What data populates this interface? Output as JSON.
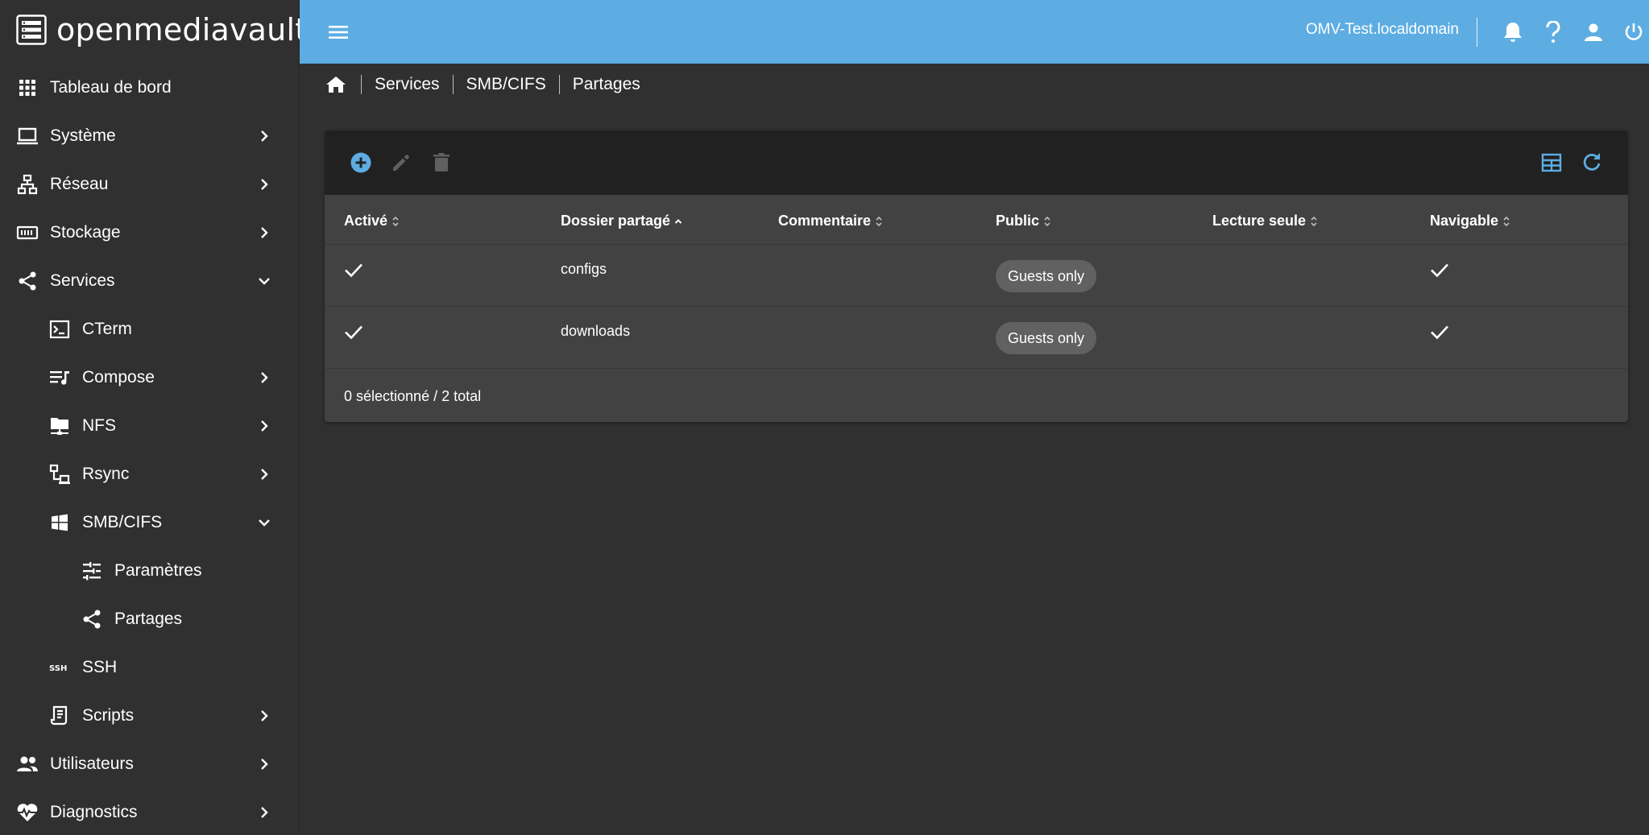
{
  "brand": {
    "name": "openmediavault"
  },
  "topbar": {
    "hostname": "OMV-Test.localdomain"
  },
  "sidebar": {
    "items": [
      {
        "label": "Tableau de bord",
        "icon": "dashboard-grid-icon"
      },
      {
        "label": "Système",
        "icon": "laptop-icon"
      },
      {
        "label": "Réseau",
        "icon": "network-icon"
      },
      {
        "label": "Stockage",
        "icon": "storage-icon"
      },
      {
        "label": "Services",
        "icon": "share-icon"
      },
      {
        "label": "CTerm",
        "icon": "console-icon"
      },
      {
        "label": "Compose",
        "icon": "playlist-music-icon"
      },
      {
        "label": "NFS",
        "icon": "folder-network-icon"
      },
      {
        "label": "Rsync",
        "icon": "lan-icon"
      },
      {
        "label": "SMB/CIFS",
        "icon": "windows-icon"
      },
      {
        "label": "Paramètres",
        "icon": "tune-icon"
      },
      {
        "label": "Partages",
        "icon": "share-icon"
      },
      {
        "label": "SSH",
        "icon": "ssh-icon"
      },
      {
        "label": "Scripts",
        "icon": "script-icon"
      },
      {
        "label": "Utilisateurs",
        "icon": "users-icon"
      },
      {
        "label": "Diagnostics",
        "icon": "heart-pulse-icon"
      }
    ]
  },
  "breadcrumb": [
    "Services",
    "SMB/CIFS",
    "Partages"
  ],
  "table": {
    "columns": [
      "Activé",
      "Dossier partagé",
      "Commentaire",
      "Public",
      "Lecture seule",
      "Navigable"
    ],
    "sorted_column": "Dossier partagé",
    "rows": [
      {
        "enabled": true,
        "shared_folder": "configs",
        "comment": "",
        "public": "Guests only",
        "read_only": false,
        "browsable": true
      },
      {
        "enabled": true,
        "shared_folder": "downloads",
        "comment": "",
        "public": "Guests only",
        "read_only": false,
        "browsable": true
      }
    ],
    "footer": "0 sélectionné / 2 total"
  },
  "colors": {
    "accent": "#5dade2",
    "background": "#303030",
    "card": "#424242",
    "toolbar": "#212121",
    "chip": "#616161"
  }
}
